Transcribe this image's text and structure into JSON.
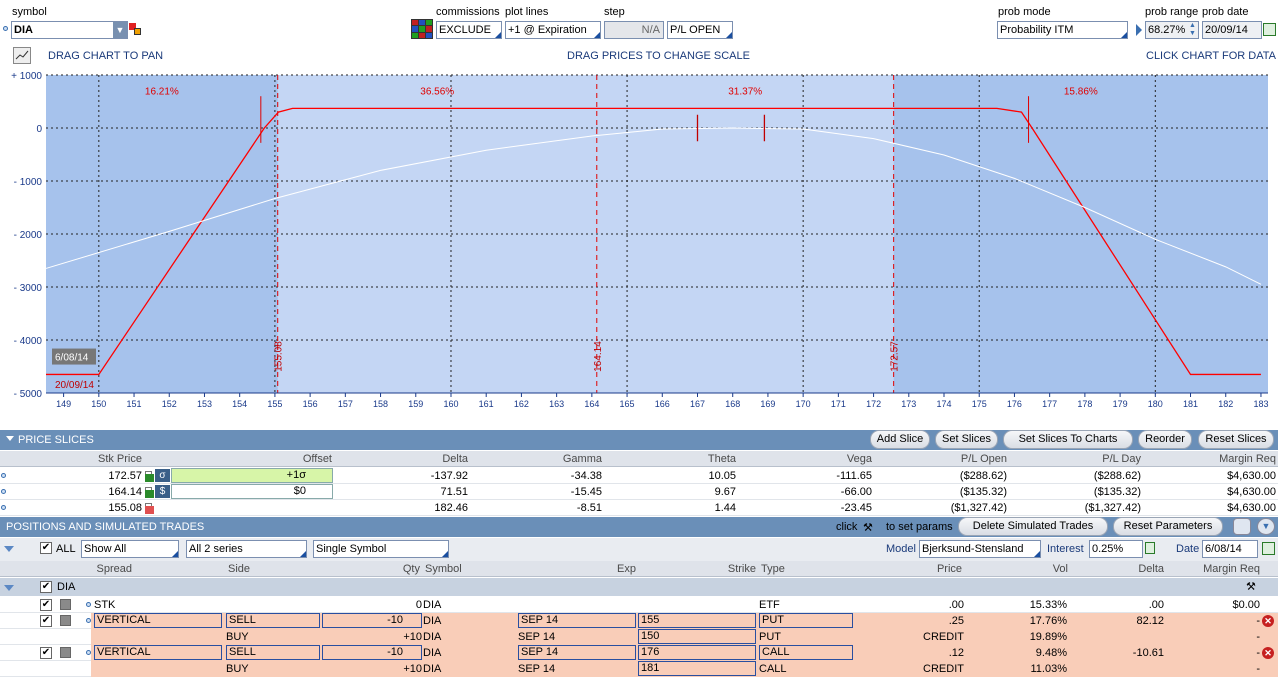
{
  "top": {
    "symbol_label": "symbol",
    "symbol_value": "DIA",
    "commissions_label": "commissions",
    "commissions_value": "EXCLUDE",
    "plotlines_label": "plot lines",
    "plotlines_value": "+1 @ Expiration",
    "step_label": "step",
    "step_value": "N/A",
    "pl_value": "P/L OPEN",
    "probmode_label": "prob mode",
    "probmode_value": "Probability ITM",
    "probrange_label": "prob range",
    "probrange_value": "68.27%",
    "probdate_label": "prob date",
    "probdate_value": "20/09/14"
  },
  "chart_bar": {
    "pan": "DRAG CHART TO PAN",
    "scale": "DRAG PRICES TO CHANGE SCALE",
    "data": "CLICK CHART FOR DATA"
  },
  "chart_data": {
    "type": "line",
    "yticks": [
      "+ 1000",
      "0",
      "- 1000",
      "- 2000",
      "- 3000",
      "- 4000",
      "- 5000"
    ],
    "xticks": [
      "149",
      "150",
      "151",
      "152",
      "153",
      "154",
      "155",
      "156",
      "157",
      "158",
      "159",
      "160",
      "161",
      "162",
      "163",
      "164",
      "165",
      "166",
      "167",
      "168",
      "169",
      "170",
      "171",
      "172",
      "173",
      "174",
      "175",
      "176",
      "177",
      "178",
      "179",
      "180",
      "181",
      "182",
      "183"
    ],
    "ylim": [
      -5000,
      1000
    ],
    "xlim": [
      148.5,
      183.2
    ],
    "probabilities": [
      "16.21%",
      "36.56%",
      "31.37%",
      "15.86%"
    ],
    "slice_labels": [
      "155.08",
      "164.14",
      "172.57"
    ],
    "date_labels": [
      "6/08/14",
      "20/09/14"
    ],
    "series": [
      {
        "name": "+1 @ Expiration",
        "color": "#ff0000",
        "points": [
          [
            148.5,
            -4650
          ],
          [
            150,
            -4650
          ],
          [
            154.7,
            0
          ],
          [
            155.1,
            300
          ],
          [
            155.5,
            370
          ],
          [
            175.5,
            370
          ],
          [
            176.2,
            300
          ],
          [
            176.5,
            0
          ],
          [
            181,
            -4650
          ],
          [
            183,
            -4650
          ]
        ]
      },
      {
        "name": "P/L OPEN",
        "color": "#ffffff",
        "points": [
          [
            148.5,
            -2650
          ],
          [
            152,
            -1950
          ],
          [
            155,
            -1330
          ],
          [
            158,
            -800
          ],
          [
            161,
            -420
          ],
          [
            164,
            -150
          ],
          [
            166,
            -20
          ],
          [
            168,
            0
          ],
          [
            170,
            -20
          ],
          [
            172,
            -200
          ],
          [
            174,
            -510
          ],
          [
            176,
            -950
          ],
          [
            178,
            -1500
          ],
          [
            180,
            -2100
          ],
          [
            182,
            -2620
          ],
          [
            183,
            -2950
          ]
        ]
      }
    ]
  },
  "price_slices": {
    "title": "PRICE SLICES",
    "buttons": [
      "Add Slice",
      "Set Slices",
      "Set Slices To Charts",
      "Reorder",
      "Reset Slices"
    ],
    "headers": [
      "Stk Price",
      "Offset",
      "Delta",
      "Gamma",
      "Theta",
      "Vega",
      "P/L Open",
      "P/L Day",
      "Margin Req"
    ],
    "rows": [
      {
        "price": "172.57",
        "offset": "+1σ",
        "delta": "-137.92",
        "gamma": "-34.38",
        "theta": "10.05",
        "vega": "-111.65",
        "plopen": "($288.62)",
        "plday": "($288.62)",
        "margin": "$4,630.00"
      },
      {
        "price": "164.14",
        "offset": "$0",
        "delta": "71.51",
        "gamma": "-15.45",
        "theta": "9.67",
        "vega": "-66.00",
        "plopen": "($135.32)",
        "plday": "($135.32)",
        "margin": "$4,630.00"
      },
      {
        "price": "155.08",
        "offset": "",
        "delta": "182.46",
        "gamma": "-8.51",
        "theta": "1.44",
        "vega": "-23.45",
        "plopen": "($1,327.42)",
        "plday": "($1,327.42)",
        "margin": "$4,630.00"
      }
    ]
  },
  "positions": {
    "title": "POSITIONS AND SIMULATED TRADES",
    "click_text": "click",
    "set_params": "to set params",
    "delete_btn": "Delete Simulated Trades",
    "reset_btn": "Reset Parameters",
    "all_label": "ALL",
    "show_all": "Show All",
    "series": "All 2 series",
    "single_symbol": "Single Symbol",
    "model_label": "Model",
    "model_value": "Bjerksund-Stensland",
    "interest_label": "Interest",
    "interest_value": "0.25%",
    "date_label": "Date",
    "date_value": "6/08/14",
    "headers": [
      "Spread",
      "Side",
      "Qty",
      "Symbol",
      "Exp",
      "Strike",
      "Type",
      "Price",
      "Vol",
      "Delta",
      "Margin Req"
    ],
    "group": "DIA",
    "rows": [
      {
        "spread": "STK",
        "side": "",
        "qty": "0",
        "symbol": "DIA",
        "exp": "",
        "strike": "",
        "type": "ETF",
        "price": ".00",
        "vol": "15.33%",
        "delta": ".00",
        "margin": "$0.00"
      },
      {
        "spread": "VERTICAL",
        "side": "SELL",
        "qty": "-10",
        "symbol": "DIA",
        "exp": "SEP 14",
        "strike": "155",
        "type": "PUT",
        "price": ".25",
        "vol": "17.76%",
        "delta": "82.12",
        "margin": "-"
      },
      {
        "spread": "",
        "side": "BUY",
        "qty": "+10",
        "symbol": "DIA",
        "exp": "SEP 14",
        "strike": "150",
        "type": "PUT",
        "price": "CREDIT",
        "vol": "19.89%",
        "delta": "",
        "margin": "-"
      },
      {
        "spread": "VERTICAL",
        "side": "SELL",
        "qty": "-10",
        "symbol": "DIA",
        "exp": "SEP 14",
        "strike": "176",
        "type": "CALL",
        "price": ".12",
        "vol": "9.48%",
        "delta": "-10.61",
        "margin": "-"
      },
      {
        "spread": "",
        "side": "BUY",
        "qty": "+10",
        "symbol": "DIA",
        "exp": "SEP 14",
        "strike": "181",
        "type": "CALL",
        "price": "CREDIT",
        "vol": "11.03%",
        "delta": "",
        "margin": "-"
      }
    ]
  }
}
